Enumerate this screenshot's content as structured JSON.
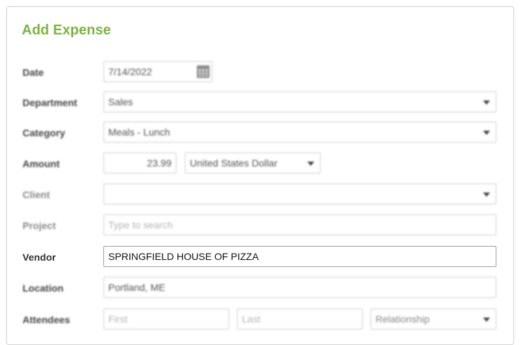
{
  "form": {
    "title": "Add Expense",
    "date": {
      "label": "Date",
      "value": "7/14/2022"
    },
    "department": {
      "label": "Department",
      "value": "Sales"
    },
    "category": {
      "label": "Category",
      "value": "Meals - Lunch"
    },
    "amount": {
      "label": "Amount",
      "value": "23.99",
      "currency": "United States Dollar"
    },
    "client": {
      "label": "Client",
      "value": ""
    },
    "project": {
      "label": "Project",
      "placeholder": "Type to search"
    },
    "vendor": {
      "label": "Vendor",
      "value": "SPRINGFIELD HOUSE OF PIZZA"
    },
    "location": {
      "label": "Location",
      "value": "Portland, ME"
    },
    "attendees": {
      "label": "Attendees",
      "first_placeholder": "First",
      "last_placeholder": "Last",
      "relationship_placeholder": "Relationship"
    }
  },
  "colors": {
    "title": "#7cb342",
    "label": "#444444",
    "border": "#cfcfcf"
  }
}
